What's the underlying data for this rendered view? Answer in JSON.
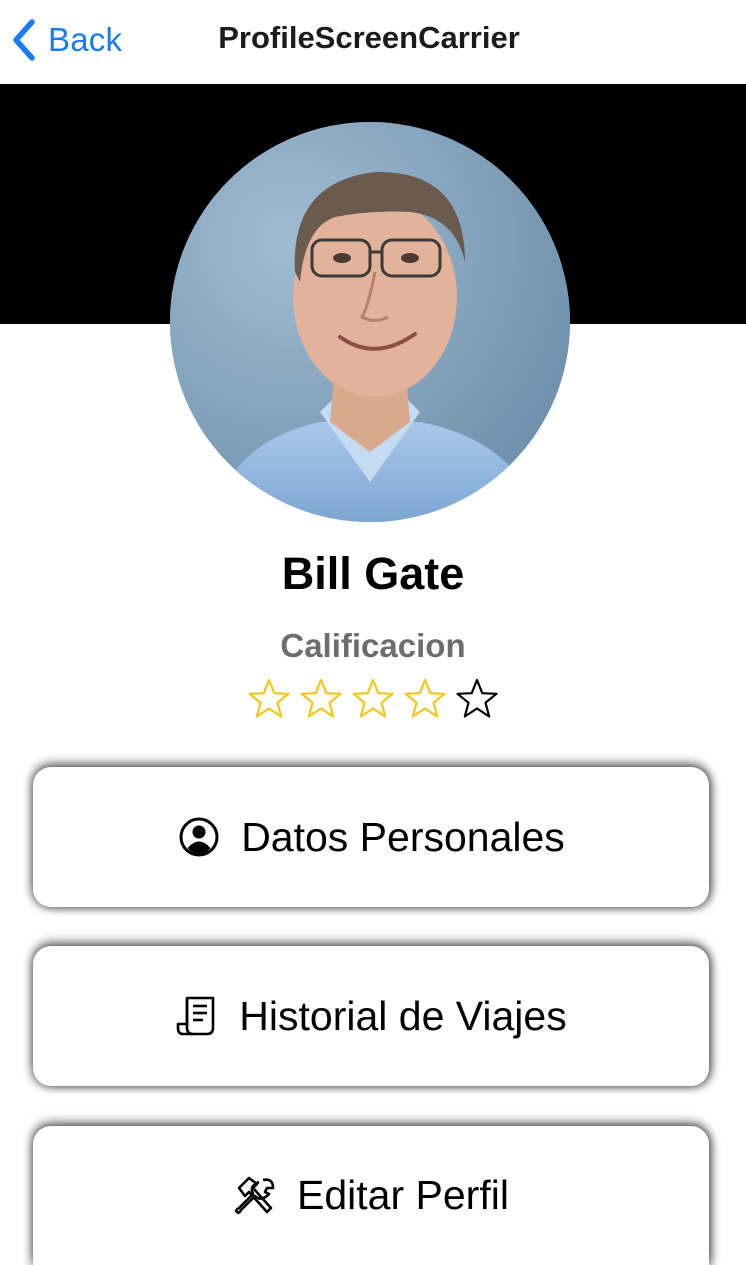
{
  "navbar": {
    "back_label": "Back",
    "title": "ProfileScreenCarrier"
  },
  "profile": {
    "name": "Bill Gate",
    "rating_label": "Calificacion",
    "rating": 4,
    "rating_max": 5
  },
  "menu": [
    {
      "label": "Datos Personales",
      "icon": "user-circle-icon"
    },
    {
      "label": "Historial de Viajes",
      "icon": "receipt-icon"
    },
    {
      "label": "Editar Perfil",
      "icon": "tools-icon"
    }
  ],
  "colors": {
    "accent": "#1a7cf0",
    "star_filled": "#f5c518",
    "banner": "#000000"
  }
}
